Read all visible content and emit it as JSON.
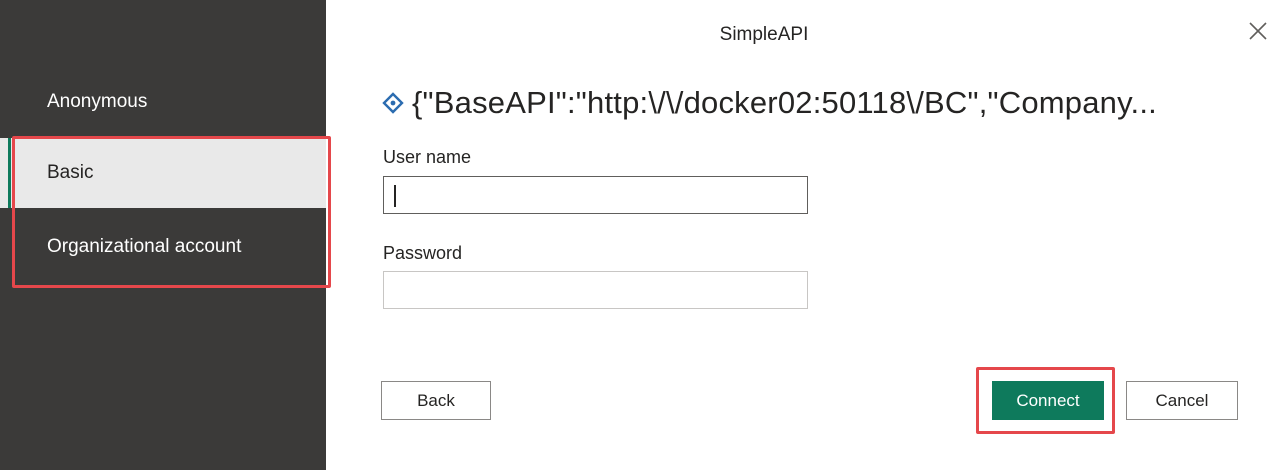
{
  "dialog": {
    "title": "SimpleAPI",
    "url": "{\"BaseAPI\":\"http:\\/\\/docker02:50118\\/BC\",\"Company..."
  },
  "sidebar": {
    "items": [
      {
        "label": "Anonymous"
      },
      {
        "label": "Basic",
        "selected": true
      },
      {
        "label": "Organizational account"
      }
    ]
  },
  "form": {
    "username_label": "User name",
    "username_value": "",
    "password_label": "Password",
    "password_value": ""
  },
  "buttons": {
    "back": "Back",
    "connect": "Connect",
    "cancel": "Cancel"
  },
  "colors": {
    "sidebar_bg": "#3b3a39",
    "selected_bg": "#e9e9e9",
    "accent": "#0e7a5c",
    "highlight": "#e5474b",
    "icon": "#2b6cb0"
  },
  "icons": {
    "url_icon": "diamond-link-icon",
    "close": "close-icon"
  }
}
